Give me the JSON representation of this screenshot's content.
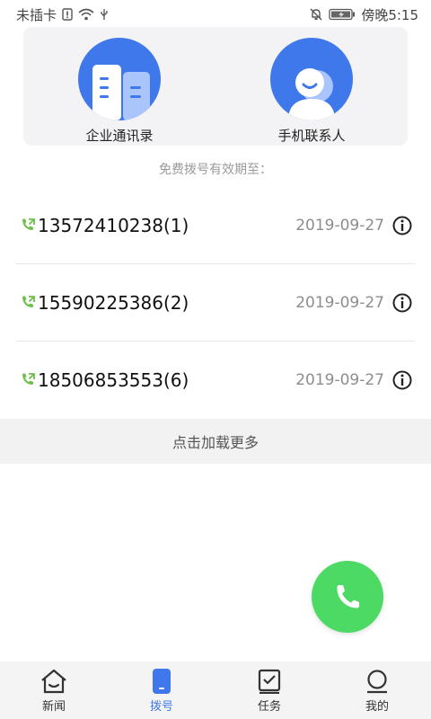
{
  "status_bar": {
    "carrier": "未插卡",
    "time": "傍晚5:15"
  },
  "contacts": {
    "enterprise_label": "企业通讯录",
    "phone_label": "手机联系人"
  },
  "valid_hint": "免费拨号有效期至：",
  "numbers": [
    {
      "number": "13572410238(1)",
      "date": "2019-09-27"
    },
    {
      "number": "15590225386(2)",
      "date": "2019-09-27"
    },
    {
      "number": "18506853553(6)",
      "date": "2019-09-27"
    }
  ],
  "load_more": "点击加载更多",
  "nav": {
    "items": [
      {
        "label": "新闻",
        "icon": "home-icon"
      },
      {
        "label": "拨号",
        "icon": "phone-device-icon",
        "active": true
      },
      {
        "label": "任务",
        "icon": "task-check-icon"
      },
      {
        "label": "我的",
        "icon": "profile-icon"
      }
    ]
  },
  "colors": {
    "accent": "#3f78ea",
    "call_green": "#4cd964",
    "date_gray": "#8d8d8d"
  }
}
